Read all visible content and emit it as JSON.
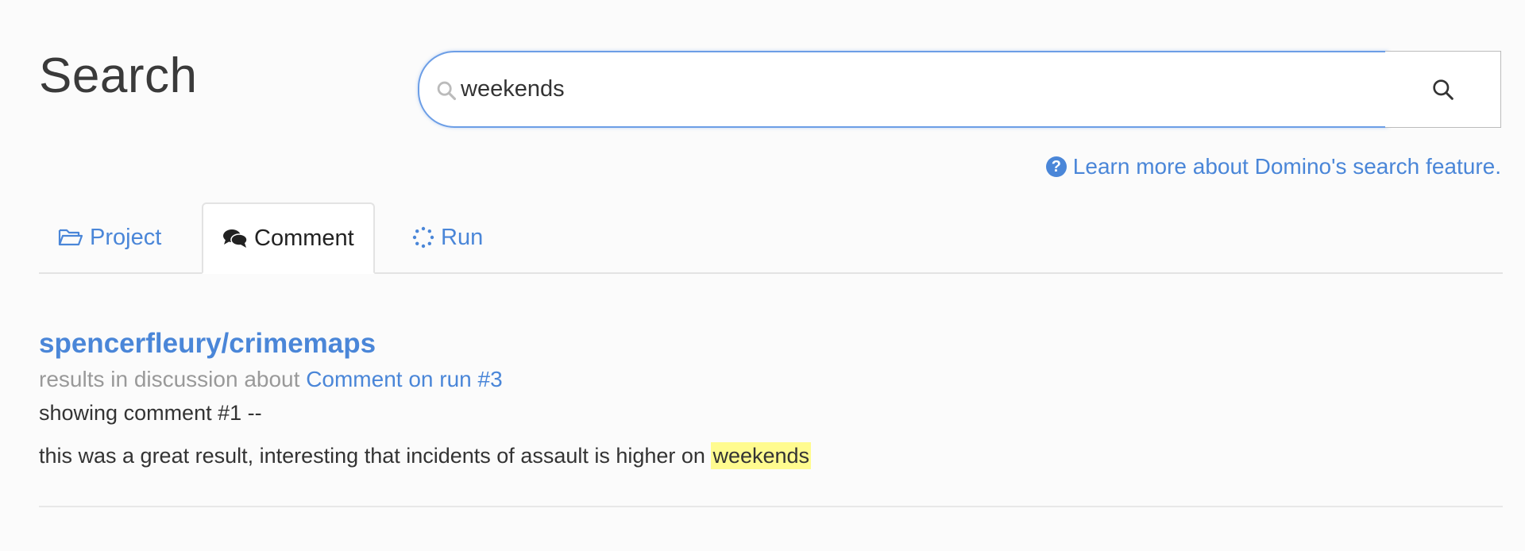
{
  "page": {
    "title": "Search"
  },
  "search": {
    "value": "weekends"
  },
  "help": {
    "link_text": "Learn more about Domino's search feature."
  },
  "tabs": [
    {
      "label": "Project",
      "icon": "folder-open-icon",
      "active": false
    },
    {
      "label": "Comment",
      "icon": "comments-icon",
      "active": true
    },
    {
      "label": "Run",
      "icon": "spinner-icon",
      "active": false
    }
  ],
  "result": {
    "title": "spencerfleury/crimemaps",
    "meta_prefix": "results in discussion about",
    "meta_link": "Comment on run #3",
    "showing": "showing comment #1 --",
    "body_prefix": "this was a great result, interesting that incidents of assault is higher on",
    "body_highlight": "weekends"
  },
  "colors": {
    "accent": "#4a86d8",
    "highlight": "#fffb8f",
    "focus_border": "#6c9ee6"
  }
}
